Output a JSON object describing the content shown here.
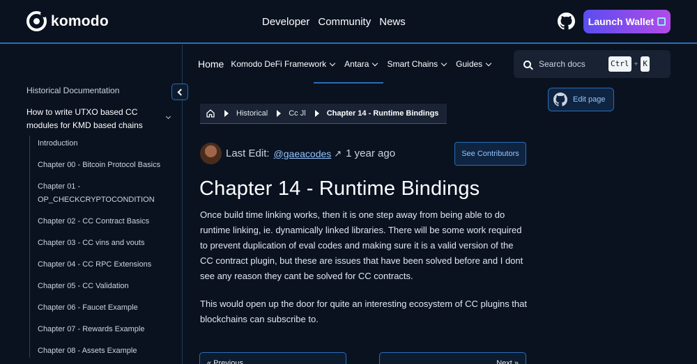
{
  "brand": {
    "name": "komodo"
  },
  "topnav": {
    "links": [
      "Developer",
      "Community",
      "News"
    ],
    "launch_label": "Launch Wallet"
  },
  "subnav": {
    "home": "Home",
    "items": [
      "Komodo DeFi Framework",
      "Antara",
      "Smart Chains",
      "Guides"
    ]
  },
  "search": {
    "placeholder": "Search docs",
    "key1": "Ctrl",
    "plus": "+",
    "key2": "K"
  },
  "sidebar": {
    "title": "Historical Documentation",
    "section": "How to write UTXO based CC modules for KMD based chains",
    "items": [
      "Introduction",
      "Chapter 00 - Bitcoin Protocol Basics",
      "Chapter 01 - OP_CHECKCRYPTOCONDITION",
      "Chapter 02 - CC Contract Basics",
      "Chapter 03 - CC vins and vouts",
      "Chapter 04 - CC RPC Extensions",
      "Chapter 05 - CC Validation",
      "Chapter 06 - Faucet Example",
      "Chapter 07 - Rewards Example",
      "Chapter 08 - Assets Example"
    ]
  },
  "breadcrumb": {
    "items": [
      "Historical",
      "Cc Jl"
    ],
    "current": "Chapter 14 - Runtime Bindings"
  },
  "meta": {
    "last_edit_label": "Last Edit:",
    "author": "@gaeacodes",
    "arrow": "↗",
    "ago": "1 year ago",
    "contributors_label": "See Contributors"
  },
  "article": {
    "title": "Chapter 14 - Runtime Bindings",
    "paragraphs": [
      "Once build time linking works, then it is one step away from being able to do runtime linking, ie. dynamically linked libraries. There will be some work required to prevent duplication of eval codes and making sure it is a valid version of the CC contract plugin, but these are issues that have been solved before and I dont see any reason they cant be solved for CC contracts.",
      "This would open up the door for quite an interesting ecosystem of CC plugins that blockchains can subscribe to."
    ]
  },
  "pagination": {
    "prev": "« Previous",
    "next": "Next »"
  },
  "edit": {
    "label": "Edit page"
  },
  "icons": [
    "komodo-logo-icon",
    "github-icon",
    "external-link-icon",
    "chevron-down-icon",
    "search-icon",
    "chevron-left-icon",
    "home-icon",
    "breadcrumb-separator-icon",
    "arrow-up-right-icon"
  ],
  "colors": {
    "accent": "#2a6db8",
    "background": "#0a1220",
    "link": "#93c5fd",
    "launch_gradient_start": "#5b4df0",
    "launch_gradient_end": "#b24be8"
  }
}
